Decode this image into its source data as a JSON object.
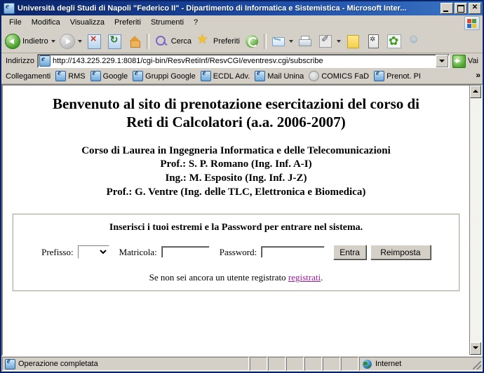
{
  "window": {
    "title": "Università degli Studi di Napoli \"Federico II\" - Dipartimento di Informatica e Sistemistica - Microsoft Inter...",
    "minimize_label": "",
    "maximize_label": "",
    "close_label": "✕"
  },
  "menu": {
    "items": [
      {
        "label": "File"
      },
      {
        "label": "Modifica"
      },
      {
        "label": "Visualizza"
      },
      {
        "label": "Preferiti"
      },
      {
        "label": "Strumenti"
      },
      {
        "label": "?"
      }
    ]
  },
  "toolbar": {
    "back_label": "Indietro",
    "search_label": "Cerca",
    "favorites_label": "Preferiti"
  },
  "address": {
    "label": "Indirizzo",
    "url": "http://143.225.229.1:8081/cgi-bin/ResvRetiInf/ResvCGI/eventresv.cgi/subscribe",
    "go_label": "Vai"
  },
  "links": {
    "label": "Collegamenti",
    "items": [
      {
        "label": "RMS",
        "icon": "ie-page-icon"
      },
      {
        "label": "Google",
        "icon": "ie-page-icon"
      },
      {
        "label": "Gruppi Google",
        "icon": "ie-page-icon"
      },
      {
        "label": "ECDL Adv.",
        "icon": "ie-page-icon"
      },
      {
        "label": "Mail Unina",
        "icon": "ie-page-icon"
      },
      {
        "label": "COMICS FaD",
        "icon": "grey-circle-icon"
      },
      {
        "label": "Prenot. PI",
        "icon": "ie-page-icon"
      }
    ],
    "overflow_label": "»"
  },
  "page": {
    "title_line1": "Benvenuto al sito di prenotazione esercitazioni del corso di",
    "title_line2": "Reti di Calcolatori (a.a. 2006-2007)",
    "subtitle_lines": [
      "Corso di Laurea in Ingegneria Informatica e delle Telecomunicazioni",
      "Prof.: S. P. Romano (Ing. Inf. A-I)",
      "Ing.: M. Esposito (Ing. Inf. J-Z)",
      "Prof.: G. Ventre (Ing. delle TLC, Elettronica e Biomedica)"
    ],
    "form": {
      "heading": "Inserisci i tuoi estremi e la Password per entrare nel sistema.",
      "prefisso_label": "Prefisso:",
      "prefisso_value": "",
      "matricola_label": "Matricola:",
      "matricola_value": "",
      "password_label": "Password:",
      "password_value": "",
      "submit_label": "Entra",
      "reset_label": "Reimposta"
    },
    "register_text": "Se non sei ancora un utente registrato ",
    "register_link": "registrati",
    "register_suffix": ".",
    "link_color": "#9b1d9b"
  },
  "statusbar": {
    "message": "Operazione completata",
    "zone": "Internet"
  }
}
